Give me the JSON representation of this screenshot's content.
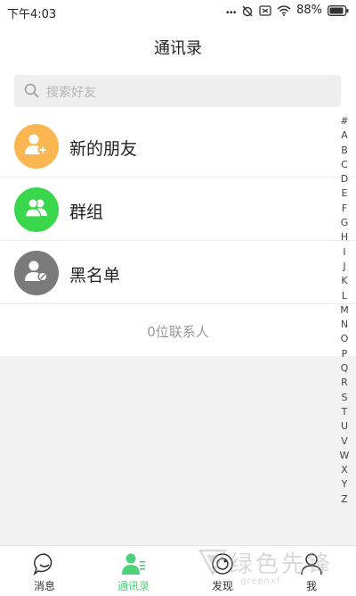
{
  "status_bar": {
    "time": "下午4:03",
    "dots": "...",
    "battery": "88%"
  },
  "header": {
    "title": "通讯录"
  },
  "search": {
    "placeholder": "搜索好友"
  },
  "list": {
    "items": [
      {
        "label": "新的朋友",
        "icon": "add-user-icon",
        "color": "#fbb651"
      },
      {
        "label": "群组",
        "icon": "group-icon",
        "color": "#3ad64b"
      },
      {
        "label": "黑名单",
        "icon": "blocked-user-icon",
        "color": "#7a7a7a"
      }
    ],
    "count_text": "0位联系人"
  },
  "index_letters": [
    "#",
    "A",
    "B",
    "C",
    "D",
    "E",
    "F",
    "G",
    "H",
    "I",
    "J",
    "K",
    "L",
    "M",
    "N",
    "O",
    "P",
    "Q",
    "R",
    "S",
    "T",
    "U",
    "V",
    "W",
    "X",
    "Y",
    "Z"
  ],
  "tabs": [
    {
      "label": "消息",
      "icon": "chat-bubble-icon",
      "active": false
    },
    {
      "label": "通讯录",
      "icon": "contacts-icon",
      "active": true
    },
    {
      "label": "发现",
      "icon": "discover-icon",
      "active": false
    },
    {
      "label": "我",
      "icon": "profile-icon",
      "active": false
    }
  ],
  "watermark": {
    "text": "绿色先锋",
    "sub": "greenxf"
  },
  "colors": {
    "accent": "#4cd37a"
  }
}
